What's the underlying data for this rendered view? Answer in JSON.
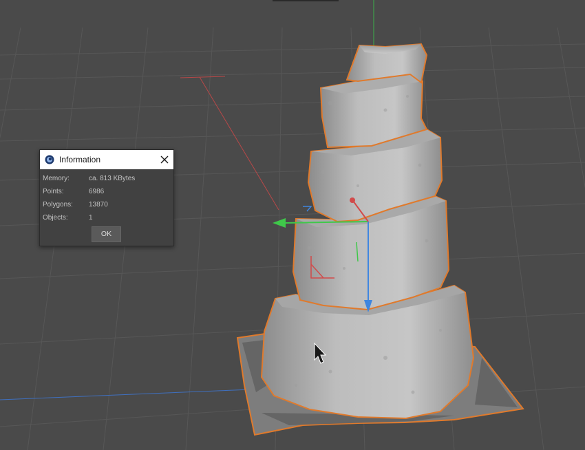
{
  "dialog": {
    "title": "Information",
    "rows": [
      {
        "label": "Memory:",
        "value": "ca. 813 KBytes"
      },
      {
        "label": "Points:",
        "value": "6986"
      },
      {
        "label": "Polygons:",
        "value": "13870"
      },
      {
        "label": "Objects:",
        "value": "1"
      }
    ],
    "ok_label": "OK"
  },
  "icons": {
    "app": "cinema4d-logo-icon",
    "close": "close-icon",
    "cursor": "mouse-pointer-icon",
    "gizmo": "move-tool-gizmo"
  },
  "colors": {
    "viewport_bg": "#4a4a4a",
    "selection_outline": "#e07a2c",
    "axis_x": "#d24a4a",
    "axis_y": "#3fc84a",
    "axis_z": "#3f86e0",
    "object": "#b8b8b8"
  }
}
